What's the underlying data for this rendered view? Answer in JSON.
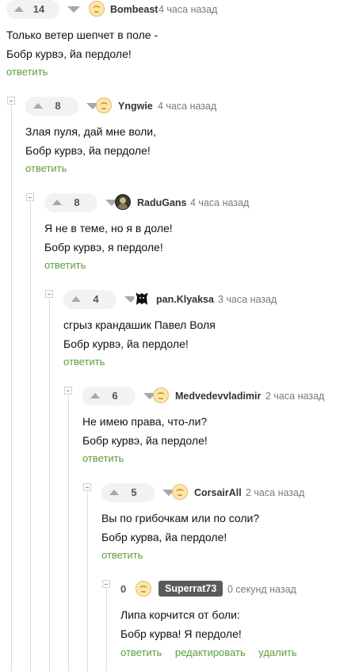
{
  "reply_label": "ответить",
  "colors": {
    "link_green": "#5a9e3a",
    "vote_pill": "#f2f2f2",
    "thread_line": "#dcdcdc",
    "badge_bg": "#5a5a5a"
  },
  "comments": [
    {
      "score": "14",
      "username": "Bombeast",
      "time": "4 часа назад",
      "avatar": "default-avatar-icon",
      "lines": [
        "Только ветер шепчет в поле -",
        "Бобр курвэ, йа пердоле!"
      ]
    },
    {
      "score": "8",
      "username": "Yngwie",
      "time": "4 часа назад",
      "avatar": "default-avatar-icon",
      "lines": [
        "Злая пуля, дай мне воли,",
        "Бобр курвэ, йа пердоле!"
      ]
    },
    {
      "score": "8",
      "username": "RaduGans",
      "time": "4 часа назад",
      "avatar": "user-photo-avatar",
      "lines": [
        "Я не в теме, но я в доле!",
        "Бобр курвэ, я пердоле!"
      ]
    },
    {
      "score": "4",
      "username": "pan.Klyaksa",
      "time": "3 часа назад",
      "avatar": "wolf-avatar-icon",
      "lines": [
        "сгрыз крандашик Павел Воля",
        "Бобр курвэ, йа пердоле!"
      ]
    },
    {
      "score": "6",
      "username": "Medvedevvladimir",
      "time": "2 часа назад",
      "avatar": "default-avatar-icon",
      "lines": [
        "Не имею права, что-ли?",
        "Бобр курвэ, йа пердоле!"
      ]
    },
    {
      "score": "5",
      "username": "CorsairAll",
      "time": "2 часа назад",
      "avatar": "default-avatar-icon",
      "lines": [
        "Вы по грибочкам или по соли?",
        "Бобр курва, йа пердоле!"
      ]
    }
  ],
  "own_comment": {
    "score": "0",
    "username": "Superrat73",
    "time": "0 секунд назад",
    "avatar": "default-avatar-icon",
    "lines": [
      "Липа корчится от боли:",
      "Бобр курва! Я пердоле!"
    ],
    "actions": {
      "reply": "ответить",
      "edit": "редактировать",
      "delete": "удалить"
    }
  }
}
